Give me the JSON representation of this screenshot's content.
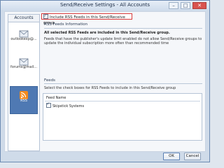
{
  "window": {
    "title": "Send/Receive Settings - All Accounts",
    "controls": {
      "minimize": "–",
      "maximize": "□",
      "close": "✕"
    }
  },
  "sidebar": {
    "header": "Accounts",
    "items": [
      {
        "label": "outlookexp@...",
        "icon": "email-account-icon",
        "selected": false
      },
      {
        "label": "forums@mail...",
        "icon": "email-account-icon",
        "selected": false
      },
      {
        "label": "RSS",
        "icon": "rss-icon",
        "selected": true
      }
    ]
  },
  "rss_feeds": {
    "include_checkbox_label": "Include RSS Feeds in this Send/Receive group",
    "include_checked": true,
    "section_title": "RSS Feeds Information",
    "info_bold": "All selected RSS Feeds are included in this Send/Receive group.",
    "info_text_1": "Feeds that have the publisher's update limit enabled do not allow Send/Receive groups to",
    "info_text_2": "update the individual subscription more often than recommended time"
  },
  "feeds": {
    "section_title": "Feeds",
    "instruction": "Select the check boxes for RSS Feeds to include in this Send/Receive group",
    "column_header": "Feed Name",
    "items": [
      {
        "name": "Skipstick Systems",
        "checked": true
      }
    ]
  },
  "buttons": {
    "ok": "OK",
    "cancel": "Cancel"
  },
  "colors": {
    "accent": "#4f79b3",
    "highlight_border": "#d83a3a",
    "rss_orange": "#f28a1e"
  }
}
